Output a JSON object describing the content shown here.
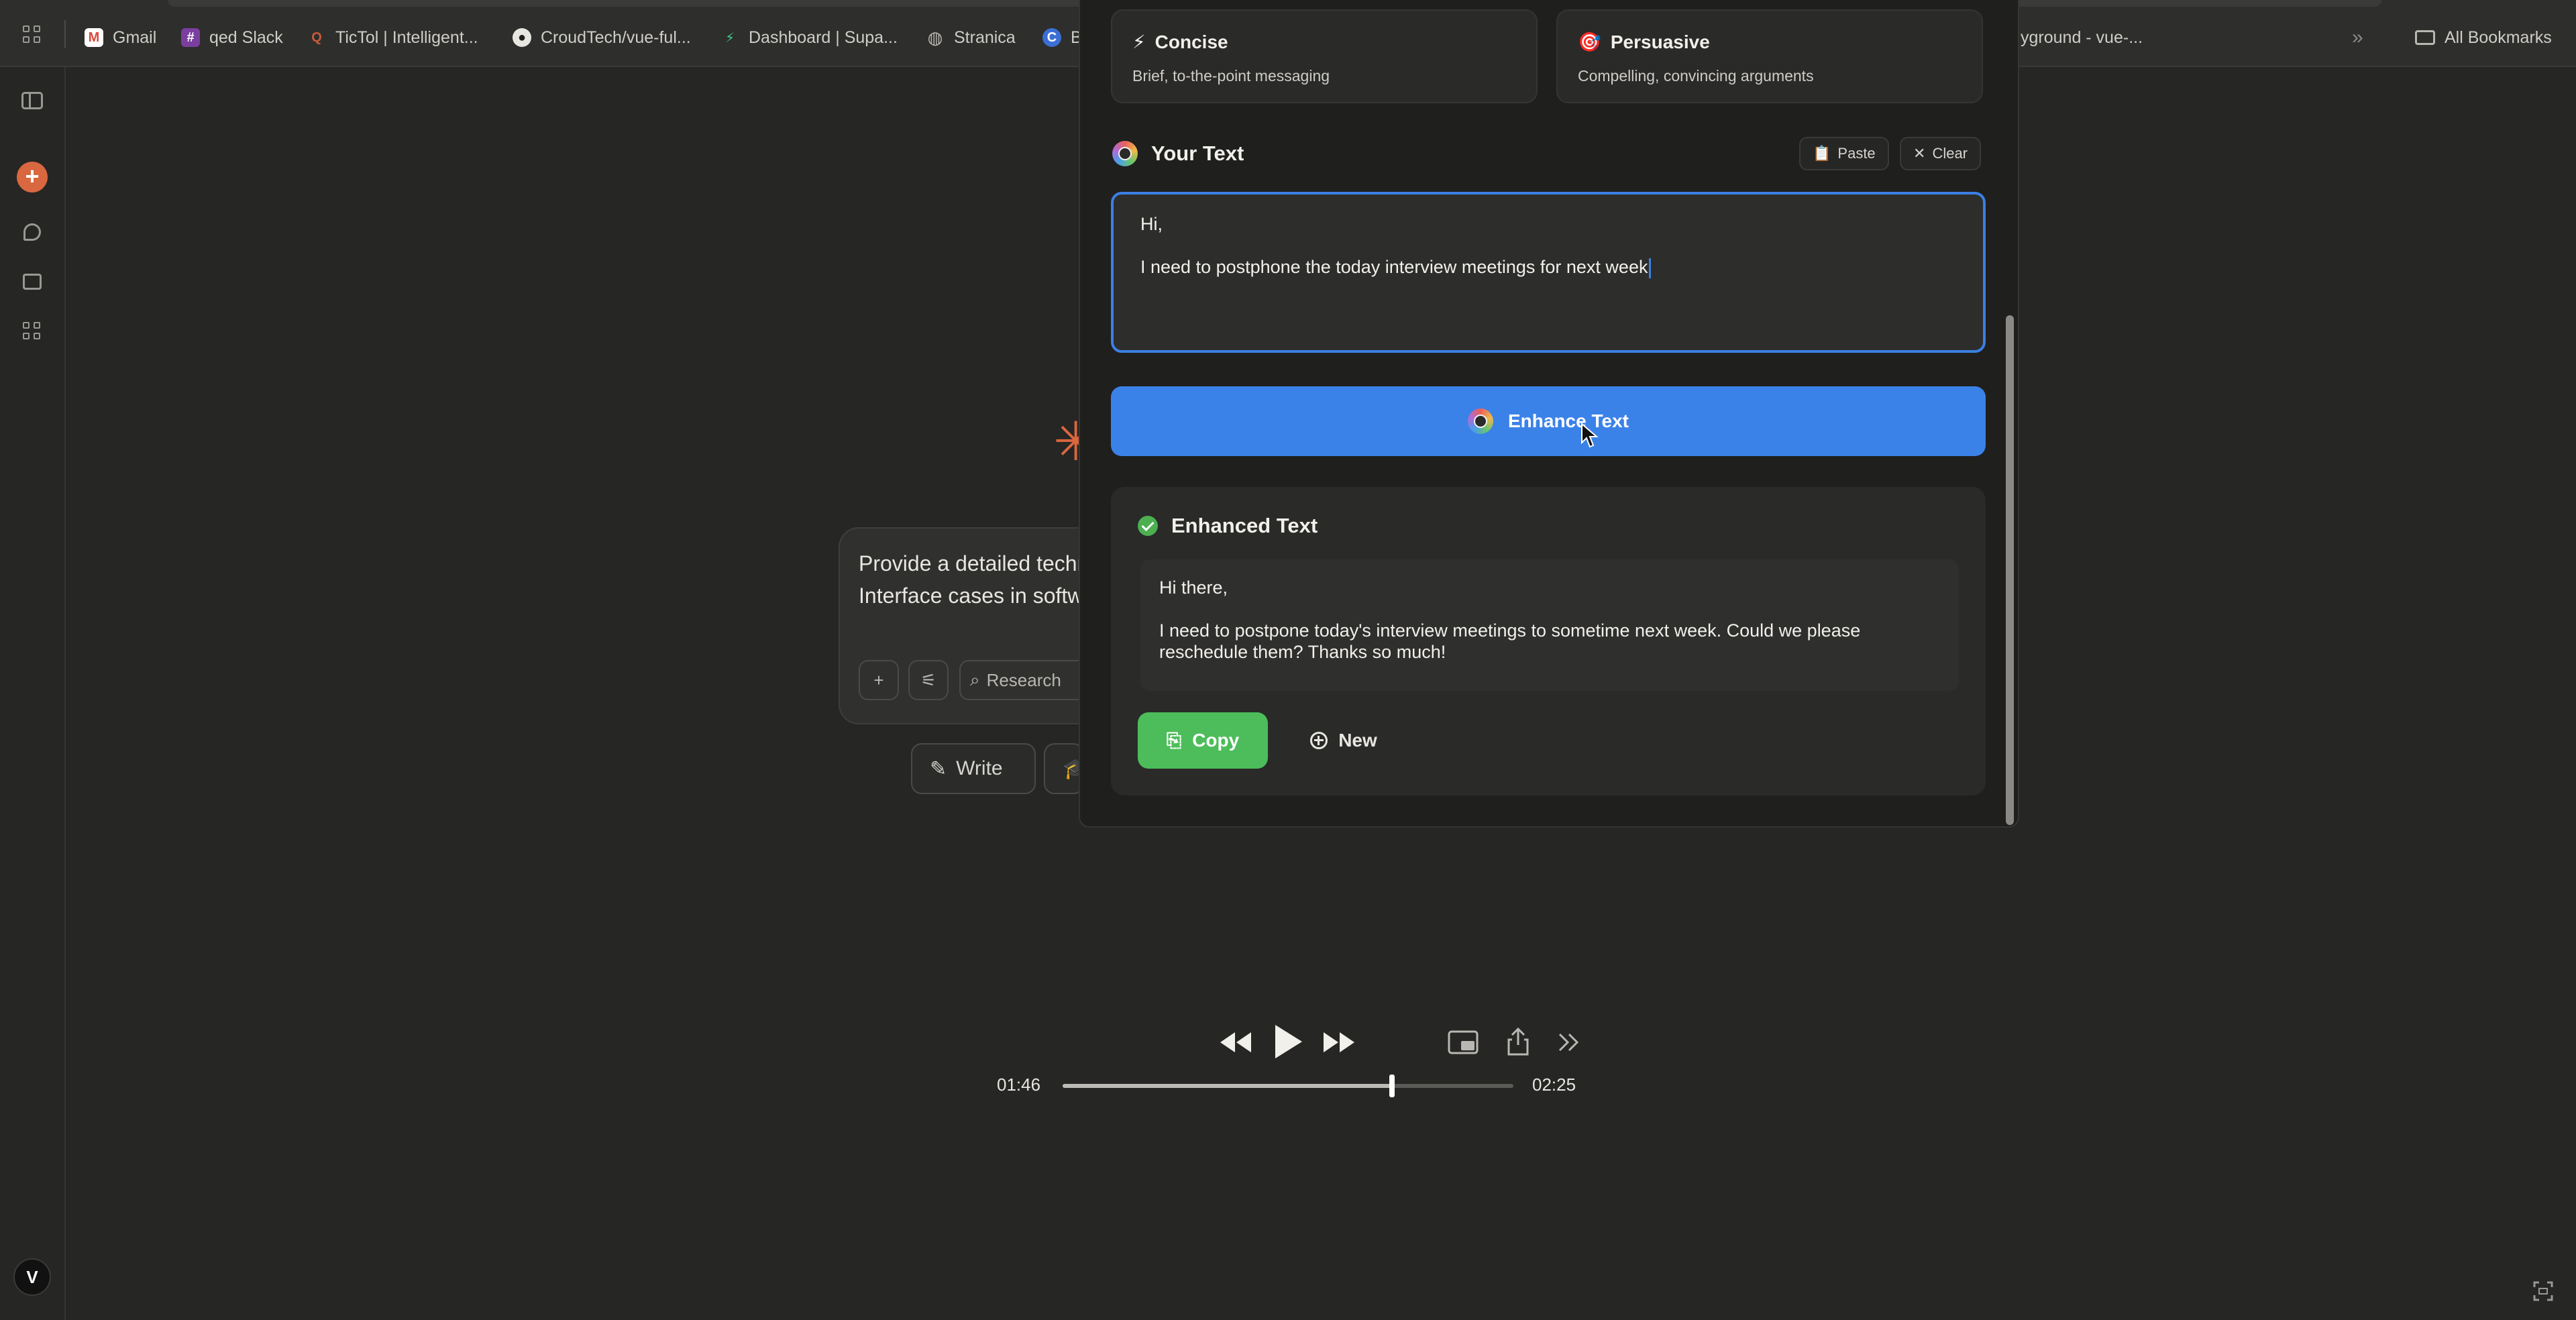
{
  "bookmarks": {
    "items": [
      {
        "label": "Gmail",
        "icon": "gmail-icon",
        "color": "#d94a3c",
        "glyph": "M"
      },
      {
        "label": "qed Slack",
        "icon": "slack-icon",
        "color": "#7b3fa0",
        "glyph": "#"
      },
      {
        "label": "TicTol | Intelligent...",
        "icon": "tictol-icon",
        "color": "#c75b39",
        "glyph": "Q"
      },
      {
        "label": "CroudTech/vue-ful...",
        "icon": "github-icon",
        "color": "#3a3a38",
        "glyph": "●"
      },
      {
        "label": "Dashboard | Supa...",
        "icon": "supabase-icon",
        "color": "#2f8f5b",
        "glyph": "⚡"
      },
      {
        "label": "Stranica",
        "icon": "globe-icon",
        "color": "#5a5a57",
        "glyph": "◍"
      },
      {
        "label": "B",
        "icon": "c-icon",
        "color": "#3b6fd4",
        "glyph": "C"
      }
    ],
    "overflow_label": "yground - vue-...",
    "all_bookmarks": "All Bookmarks"
  },
  "sidebar": {
    "avatar_initial": "V"
  },
  "background_app": {
    "prompt_text": "Provide a detailed technical Programming Interface cases in software deve",
    "research_label": "Research",
    "write_label": "Write"
  },
  "popup": {
    "styles": [
      {
        "emoji": "⚡",
        "title": "Concise",
        "desc": "Brief, to-the-point messaging"
      },
      {
        "emoji": "🎯",
        "title": "Persuasive",
        "desc": "Compelling, convincing arguments"
      }
    ],
    "your_text_title": "Your Text",
    "paste_label": "Paste",
    "clear_label": "Clear",
    "input_lines": [
      "Hi,",
      "I need to postphone the today interview meetings for next week"
    ],
    "enhance_label": "Enhance Text",
    "result_title": "Enhanced Text",
    "result_lines": [
      "Hi there,",
      "I need to postpone today's interview meetings to sometime next week. Could we please reschedule them? Thanks so much!"
    ],
    "copy_label": "Copy",
    "new_label": "New"
  },
  "media": {
    "current_time": "01:46",
    "total_time": "02:25",
    "progress_fraction": 0.731
  },
  "colors": {
    "accent_blue": "#3b82e8",
    "success_green": "#4cbd5a",
    "brand_orange": "#d9673f"
  }
}
